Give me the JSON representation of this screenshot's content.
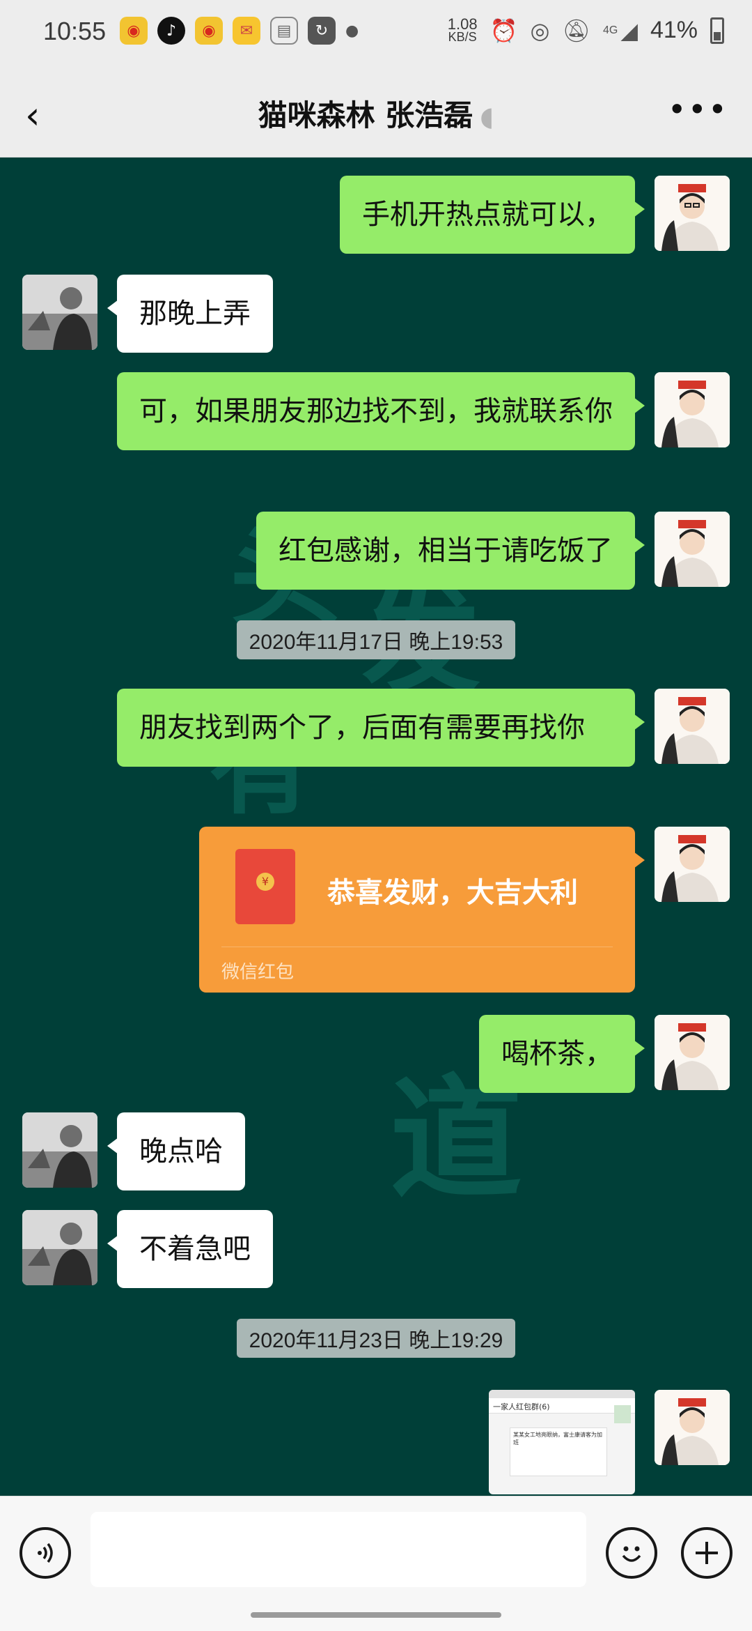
{
  "status_bar": {
    "time": "10:55",
    "net_speed_value": "1.08",
    "net_speed_unit": "KB/S",
    "network_type": "4G",
    "battery": "41%"
  },
  "header": {
    "title": "猫咪森林  张浩磊",
    "back_icon": "chevron-left-icon",
    "more_icon": "more-dots-icon"
  },
  "watermark": "头发有无道路",
  "messages": [
    {
      "from": "me",
      "text": "手机开热点就可以，"
    },
    {
      "from": "other",
      "text": "那晚上弄"
    },
    {
      "from": "me",
      "text": "可，如果朋友那边找不到，我就联系你"
    },
    {
      "from": "me",
      "text": "红包感谢，相当于请吃饭了"
    },
    {
      "timestamp": "2020年11月17日 晚上19:53"
    },
    {
      "from": "me",
      "text": "朋友找到两个了，后面有需要再找你"
    },
    {
      "from": "me",
      "type": "red_packet",
      "text": "恭喜发财，大吉大利",
      "label": "微信红包"
    },
    {
      "from": "me",
      "text": "喝杯茶，"
    },
    {
      "from": "other",
      "text": "晚点哈"
    },
    {
      "from": "other",
      "text": "不着急吧"
    },
    {
      "timestamp": "2020年11月23日 晚上19:29"
    },
    {
      "from": "me",
      "type": "image",
      "thumb_title": "一家人红包群(6)",
      "thumb_text": "某某女工地亮眼纳，富士康请客为加班"
    }
  ],
  "colors": {
    "background": "#003f38",
    "my_bubble": "#95ec69",
    "other_bubble": "#ffffff",
    "red_packet": "#f79c3a"
  },
  "input_bar": {
    "voice_icon": "voice-icon",
    "emoji_icon": "emoji-icon",
    "plus_icon": "plus-icon"
  }
}
